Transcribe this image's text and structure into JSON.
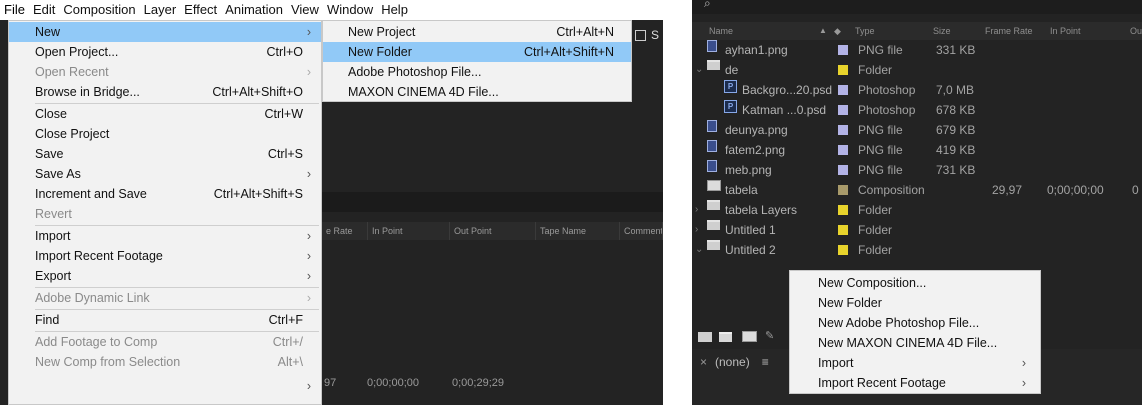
{
  "left": {
    "menubar": [
      "File",
      "Edit",
      "Composition",
      "Layer",
      "Effect",
      "Animation",
      "View",
      "Window",
      "Help"
    ],
    "file_menu": [
      {
        "label": "New",
        "shortcut": "",
        "arrow": true,
        "disabled": false,
        "highlight": true,
        "sep_after": false
      },
      {
        "label": "Open Project...",
        "shortcut": "Ctrl+O",
        "arrow": false,
        "disabled": false,
        "highlight": false,
        "sep_after": false
      },
      {
        "label": "Open Recent",
        "shortcut": "",
        "arrow": true,
        "disabled": true,
        "highlight": false,
        "sep_after": false
      },
      {
        "label": "Browse in Bridge...",
        "shortcut": "Ctrl+Alt+Shift+O",
        "arrow": false,
        "disabled": false,
        "highlight": false,
        "sep_after": true
      },
      {
        "label": "Close",
        "shortcut": "Ctrl+W",
        "arrow": false,
        "disabled": false,
        "highlight": false,
        "sep_after": false
      },
      {
        "label": "Close Project",
        "shortcut": "",
        "arrow": false,
        "disabled": false,
        "highlight": false,
        "sep_after": false
      },
      {
        "label": "Save",
        "shortcut": "Ctrl+S",
        "arrow": false,
        "disabled": false,
        "highlight": false,
        "sep_after": false
      },
      {
        "label": "Save As",
        "shortcut": "",
        "arrow": true,
        "disabled": false,
        "highlight": false,
        "sep_after": false
      },
      {
        "label": "Increment and Save",
        "shortcut": "Ctrl+Alt+Shift+S",
        "arrow": false,
        "disabled": false,
        "highlight": false,
        "sep_after": false
      },
      {
        "label": "Revert",
        "shortcut": "",
        "arrow": false,
        "disabled": true,
        "highlight": false,
        "sep_after": true
      },
      {
        "label": "Import",
        "shortcut": "",
        "arrow": true,
        "disabled": false,
        "highlight": false,
        "sep_after": false
      },
      {
        "label": "Import Recent Footage",
        "shortcut": "",
        "arrow": true,
        "disabled": false,
        "highlight": false,
        "sep_after": false
      },
      {
        "label": "Export",
        "shortcut": "",
        "arrow": true,
        "disabled": false,
        "highlight": false,
        "sep_after": true
      },
      {
        "label": "Adobe Dynamic Link",
        "shortcut": "",
        "arrow": true,
        "disabled": true,
        "highlight": false,
        "sep_after": true
      },
      {
        "label": "Find",
        "shortcut": "Ctrl+F",
        "arrow": false,
        "disabled": false,
        "highlight": false,
        "sep_after": true
      },
      {
        "label": "Add Footage to Comp",
        "shortcut": "Ctrl+/",
        "arrow": false,
        "disabled": true,
        "highlight": false,
        "sep_after": false
      },
      {
        "label": "New Comp from Selection",
        "shortcut": "Alt+\\",
        "arrow": false,
        "disabled": true,
        "highlight": false,
        "sep_after": false
      }
    ],
    "new_submenu": [
      {
        "label": "New Project",
        "shortcut": "Ctrl+Alt+N",
        "highlight": false
      },
      {
        "label": "New Folder",
        "shortcut": "Ctrl+Alt+Shift+N",
        "highlight": true
      },
      {
        "label": "Adobe Photoshop File...",
        "shortcut": "",
        "highlight": false
      },
      {
        "label": "MAXON CINEMA 4D File...",
        "shortcut": "",
        "highlight": false
      }
    ],
    "bg_s_label": "S",
    "bg_columns": [
      "e Rate",
      "In Point",
      "Out Point",
      "Tape Name",
      "Comment"
    ],
    "bg_values": [
      "97",
      "0;00;00;00",
      "0;00;29;29"
    ]
  },
  "right": {
    "columns": {
      "name": "Name",
      "type": "Type",
      "size": "Size",
      "frame_rate": "Frame Rate",
      "in_point": "In Point",
      "out": "Ou"
    },
    "rows": [
      {
        "name": "ayhan1.png",
        "icon": "png-file-icon",
        "twisty": "",
        "indent": 0,
        "label_color": "#b3b3e6",
        "type": "PNG file",
        "size": "331 KB",
        "fr": "",
        "inp": "",
        "outp": ""
      },
      {
        "name": "de",
        "icon": "folder-icon",
        "twisty": "v",
        "indent": 0,
        "label_color": "#e8d32c",
        "type": "Folder",
        "size": "",
        "fr": "",
        "inp": "",
        "outp": ""
      },
      {
        "name": "Backgro...20.psd",
        "icon": "psd-file-icon",
        "twisty": "",
        "indent": 1,
        "label_color": "#b3b3e6",
        "type": "Photoshop",
        "size": "7,0 MB",
        "fr": "",
        "inp": "",
        "outp": ""
      },
      {
        "name": "Katman ...0.psd",
        "icon": "psd-file-icon",
        "twisty": "",
        "indent": 1,
        "label_color": "#b3b3e6",
        "type": "Photoshop",
        "size": "678 KB",
        "fr": "",
        "inp": "",
        "outp": ""
      },
      {
        "name": "deunya.png",
        "icon": "png-file-icon",
        "twisty": "",
        "indent": 0,
        "label_color": "#b3b3e6",
        "type": "PNG file",
        "size": "679 KB",
        "fr": "",
        "inp": "",
        "outp": ""
      },
      {
        "name": "fatem2.png",
        "icon": "png-file-icon",
        "twisty": "",
        "indent": 0,
        "label_color": "#b3b3e6",
        "type": "PNG file",
        "size": "419 KB",
        "fr": "",
        "inp": "",
        "outp": ""
      },
      {
        "name": "meb.png",
        "icon": "png-file-icon",
        "twisty": "",
        "indent": 0,
        "label_color": "#b3b3e6",
        "type": "PNG file",
        "size": "731 KB",
        "fr": "",
        "inp": "",
        "outp": ""
      },
      {
        "name": "tabela",
        "icon": "composition-icon",
        "twisty": "",
        "indent": 0,
        "label_color": "#a89a6a",
        "type": "Composition",
        "size": "",
        "fr": "29,97",
        "inp": "0;00;00;00",
        "outp": "0"
      },
      {
        "name": "tabela Layers",
        "icon": "folder-icon",
        "twisty": ">",
        "indent": 0,
        "label_color": "#e8d32c",
        "type": "Folder",
        "size": "",
        "fr": "",
        "inp": "",
        "outp": ""
      },
      {
        "name": "Untitled 1",
        "icon": "folder-icon",
        "twisty": ">",
        "indent": 0,
        "label_color": "#e8d32c",
        "type": "Folder",
        "size": "",
        "fr": "",
        "inp": "",
        "outp": ""
      },
      {
        "name": "Untitled 2",
        "icon": "folder-icon",
        "twisty": "v",
        "indent": 0,
        "label_color": "#e8d32c",
        "type": "Folder",
        "size": "",
        "fr": "",
        "inp": "",
        "outp": ""
      }
    ],
    "context_menu": [
      {
        "label": "New Composition...",
        "arrow": false
      },
      {
        "label": "New Folder",
        "arrow": false
      },
      {
        "label": "New Adobe Photoshop File...",
        "arrow": false
      },
      {
        "label": "New MAXON CINEMA 4D File...",
        "arrow": false
      },
      {
        "label": "Import",
        "arrow": true
      },
      {
        "label": "Import Recent Footage",
        "arrow": true
      }
    ],
    "none_tab": "(none)"
  }
}
